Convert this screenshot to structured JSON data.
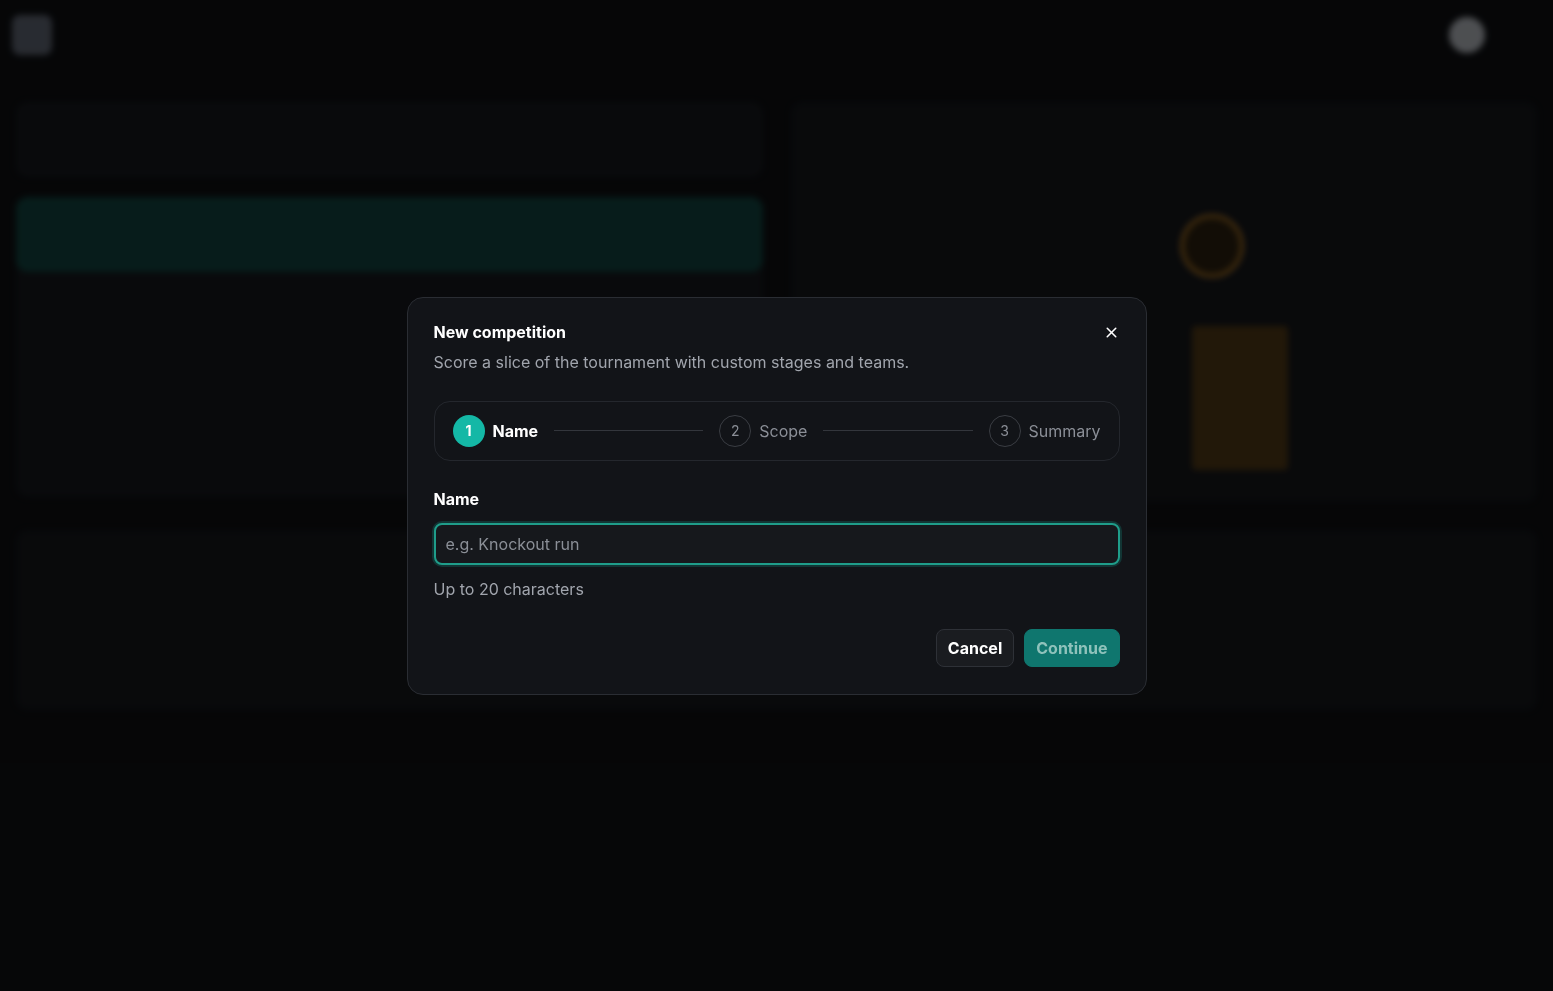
{
  "dialog": {
    "title": "New competition",
    "description": "Score a slice of the tournament with custom stages and teams.",
    "steps": [
      {
        "number": "1",
        "label": "Name",
        "selected": true
      },
      {
        "number": "2",
        "label": "Scope",
        "selected": false
      },
      {
        "number": "3",
        "label": "Summary",
        "selected": false
      }
    ],
    "field": {
      "label": "Name",
      "placeholder": "e.g. Knockout run",
      "hint": "Up to 20 characters"
    },
    "buttons": [
      {
        "kind": "secondary",
        "label": "Cancel",
        "disabled": false
      },
      {
        "kind": "primary",
        "label": "Continue",
        "disabled": true
      }
    ]
  }
}
